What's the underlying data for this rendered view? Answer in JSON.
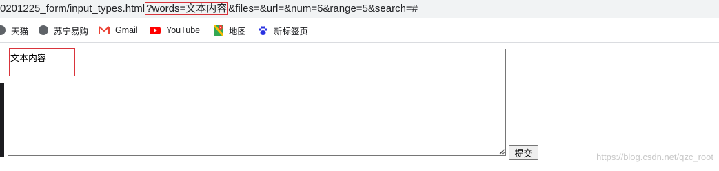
{
  "addressbar": {
    "url_before": "0201225_form/input_types.html",
    "url_highlight": "?words=文本内容",
    "url_after": "&files=&url=&num=6&range=5&search=#"
  },
  "bookmarks": [
    {
      "label": "天猫",
      "icon": "tmall-icon"
    },
    {
      "label": "苏宁易购",
      "icon": "globe-icon"
    },
    {
      "label": "Gmail",
      "icon": "gmail-icon"
    },
    {
      "label": "YouTube",
      "icon": "youtube-icon"
    },
    {
      "label": "地图",
      "icon": "maps-icon"
    },
    {
      "label": "新标签页",
      "icon": "baidu-paw-icon"
    }
  ],
  "form": {
    "textarea_value": "文本内容",
    "submit_label": "提交"
  },
  "watermark": "https://blog.csdn.net/qzc_root",
  "colors": {
    "highlight_border": "#d9343b",
    "addressbar_bg": "#f1f3f4"
  }
}
